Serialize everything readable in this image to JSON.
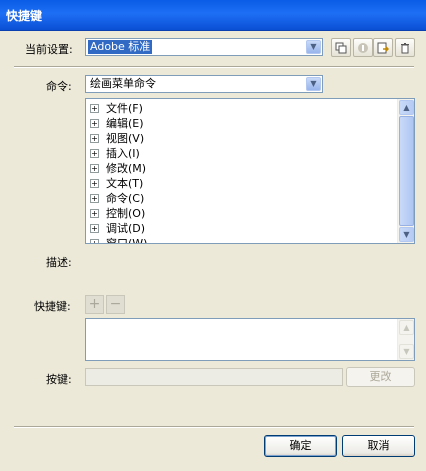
{
  "window": {
    "title": "快捷键"
  },
  "current_set": {
    "label": "当前设置:",
    "value": "Adobe 标准"
  },
  "toolbar": {
    "icons": [
      "duplicate-set-icon",
      "rename-set-icon",
      "export-set-icon",
      "delete-set-icon"
    ]
  },
  "commands": {
    "label": "命令:",
    "value": "绘画菜单命令",
    "items": [
      {
        "label": "文件(F)"
      },
      {
        "label": "编辑(E)"
      },
      {
        "label": "视图(V)"
      },
      {
        "label": "插入(I)"
      },
      {
        "label": "修改(M)"
      },
      {
        "label": "文本(T)"
      },
      {
        "label": "命令(C)"
      },
      {
        "label": "控制(O)"
      },
      {
        "label": "调试(D)"
      },
      {
        "label": "窗口(W)"
      }
    ]
  },
  "description": {
    "label": "描述:"
  },
  "shortcut": {
    "label": "快捷键:",
    "add_symbol": "+",
    "remove_symbol": "−"
  },
  "press_key": {
    "label": "按键:",
    "change_label": "更改"
  },
  "buttons": {
    "ok": "确定",
    "cancel": "取消"
  }
}
